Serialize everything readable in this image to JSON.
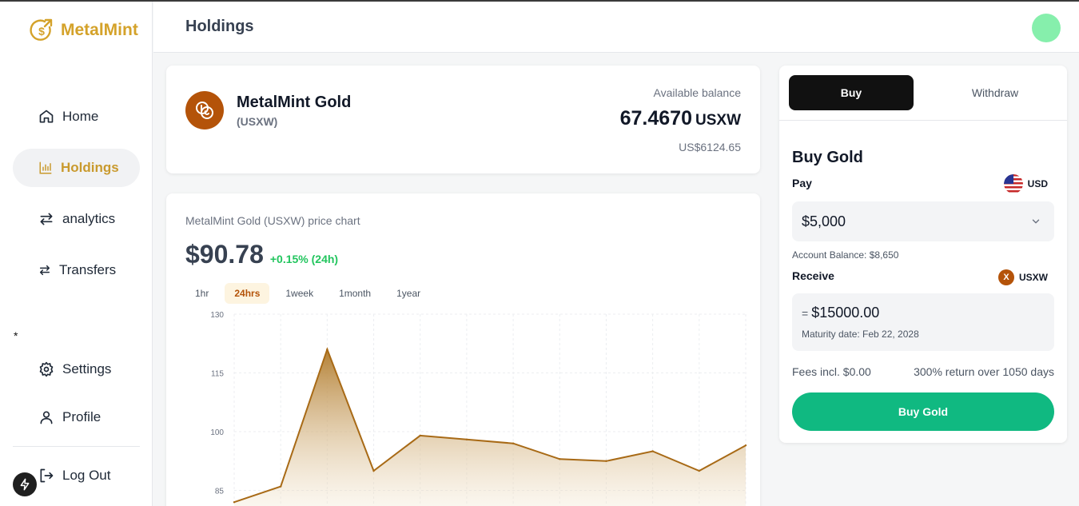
{
  "app": {
    "brand": "MetalMint"
  },
  "sidebar": {
    "items": [
      {
        "label": "Home",
        "icon": "home-icon"
      },
      {
        "label": "Holdings",
        "icon": "bar-chart-icon",
        "active": true
      },
      {
        "label": "analytics",
        "icon": "arrows-swap-icon"
      },
      {
        "label": "Transfers",
        "icon": "arrows-swap-small-icon"
      }
    ],
    "marker": "*",
    "bottom_items": [
      {
        "label": "Settings",
        "icon": "gear-icon"
      },
      {
        "label": "Profile",
        "icon": "user-icon"
      },
      {
        "label": "Log Out",
        "icon": "logout-icon"
      }
    ]
  },
  "header": {
    "title": "Holdings"
  },
  "balance": {
    "asset_name": "MetalMint Gold",
    "asset_ticker": "(USXW)",
    "label": "Available balance",
    "amount": "67.4670",
    "unit": "USXW",
    "usd_value": "US$6124.65"
  },
  "chart": {
    "title": "MetalMint Gold (USXW) price chart",
    "price": "$90.78",
    "change": "+0.15% (24h)",
    "ranges": [
      "1hr",
      "24hrs",
      "1week",
      "1month",
      "1year"
    ],
    "active_range": "24hrs"
  },
  "chart_data": {
    "type": "area",
    "title": "",
    "xlabel": "",
    "ylabel": "",
    "y_ticks": [
      130,
      115,
      100,
      85
    ],
    "ylim": [
      80,
      130
    ],
    "grid": true,
    "color": "#a86a16",
    "series": [
      {
        "values": [
          82,
          86,
          121,
          90,
          99,
          98,
          97,
          93,
          92.5,
          95,
          90,
          96.5
        ]
      }
    ]
  },
  "buy_panel": {
    "tabs": {
      "buy": "Buy",
      "withdraw": "Withdraw"
    },
    "title": "Buy Gold",
    "pay_label": "Pay",
    "pay_currency": "USD",
    "pay_amount": "$5,000",
    "account_balance": "Account Balance: $8,650",
    "receive_label": "Receive",
    "receive_currency": "USXW",
    "receive_badge": "X",
    "receive_eq": "=",
    "receive_amount": "$15000.00",
    "maturity": "Maturity date: Feb 22, 2028",
    "fees": "Fees incl. $0.00",
    "returns": "300% return over 1050 days",
    "buy_button": "Buy Gold"
  }
}
